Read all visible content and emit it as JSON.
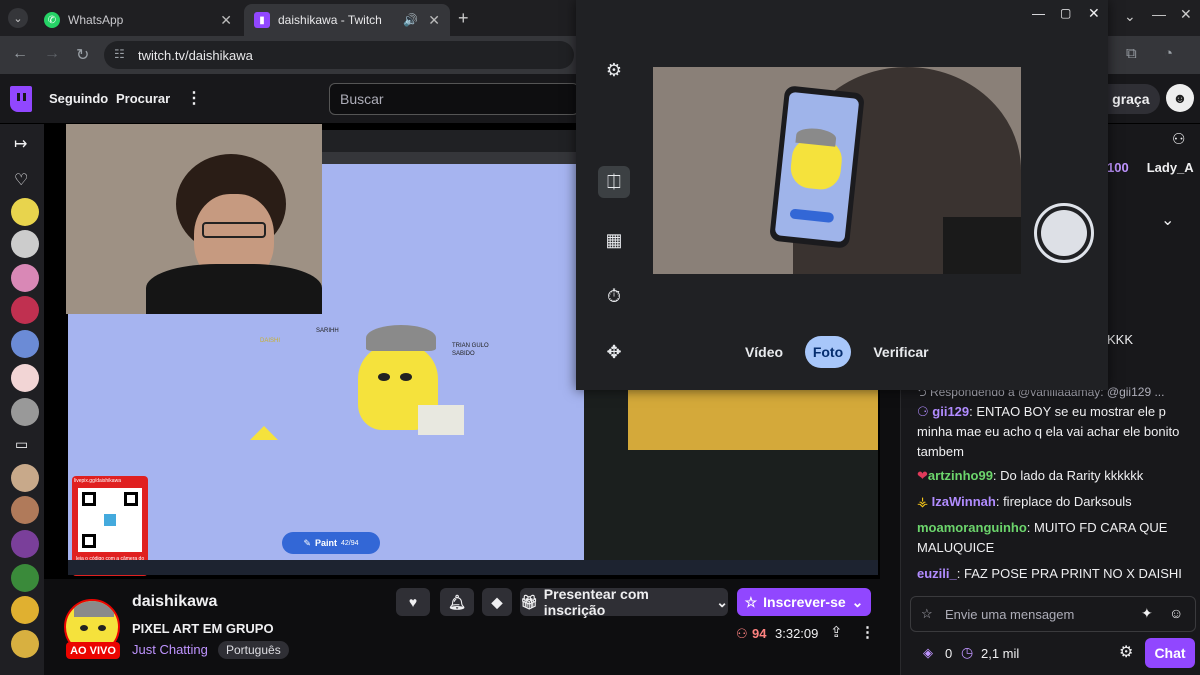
{
  "browser": {
    "tabs": [
      {
        "title": "WhatsApp",
        "icon": "whatsapp-icon",
        "active": false
      },
      {
        "title": "daishikawa - Twitch",
        "icon": "twitch-icon",
        "active": true
      }
    ],
    "url": "twitch.tv/daishikawa"
  },
  "twitch_nav": {
    "following": "Seguindo",
    "browse": "Procurar",
    "search_placeholder": "Buscar",
    "gratis_partial": "e graça"
  },
  "stream": {
    "overlay": {
      "paint_label": "Paint",
      "paint_count": "42/94",
      "qr_top": "livepix.gg/daishikawa",
      "qr_bottom": "leia o código com a câmera do celular.",
      "sabinh": "SARIHH",
      "tag_dbl": "DAISHI",
      "triang": "TRIAN GULO SABIDO"
    }
  },
  "channel": {
    "name": "daishikawa",
    "live_badge": "AO VIVO",
    "title": "PIXEL ART EM GRUPO",
    "category": "Just Chatting",
    "language": "Português",
    "viewers": "94",
    "uptime": "3:32:09",
    "gift_label": "Presentear com inscrição",
    "subscribe_label": "Inscrever-se"
  },
  "chat": {
    "top_partial_count": "100",
    "top_partial_name": "Lady_A",
    "kkk": "KKK",
    "reply_prefix": "Respondendo a @vanillaaamay: @gii129 ...",
    "messages": [
      {
        "user": "gii129",
        "color": "#b18cff",
        "text": ": ENTAO BOY se eu mostrar ele p minha mae eu acho q ela vai achar ele bonito tambem"
      },
      {
        "user": "artzinho99",
        "color": "#6cd56c",
        "text": ": Do lado da Rarity kkkkkk"
      },
      {
        "user": "IzaWinnah",
        "color": "#b18cff",
        "text": ": fireplace do Darksouls"
      },
      {
        "user": "moamoranguinho",
        "color": "#6cd56c",
        "text": ": MUITO FD CARA QUE MALUQUICE"
      },
      {
        "user": "euzili_",
        "color": "#b18cff",
        "text": ": FAZ POSE PRA PRINT NO X DAISHI"
      }
    ],
    "input_placeholder": "Envie uma mensagem",
    "bits": "0",
    "points": "2,1 mil",
    "chat_button": "Chat"
  },
  "camera": {
    "modes": [
      "Vídeo",
      "Foto",
      "Verificar"
    ],
    "active_mode": "Foto"
  },
  "colors": {
    "twitch_purple": "#9147ff",
    "live_red": "#eb0400",
    "camera_active": "#a8c7fa"
  }
}
